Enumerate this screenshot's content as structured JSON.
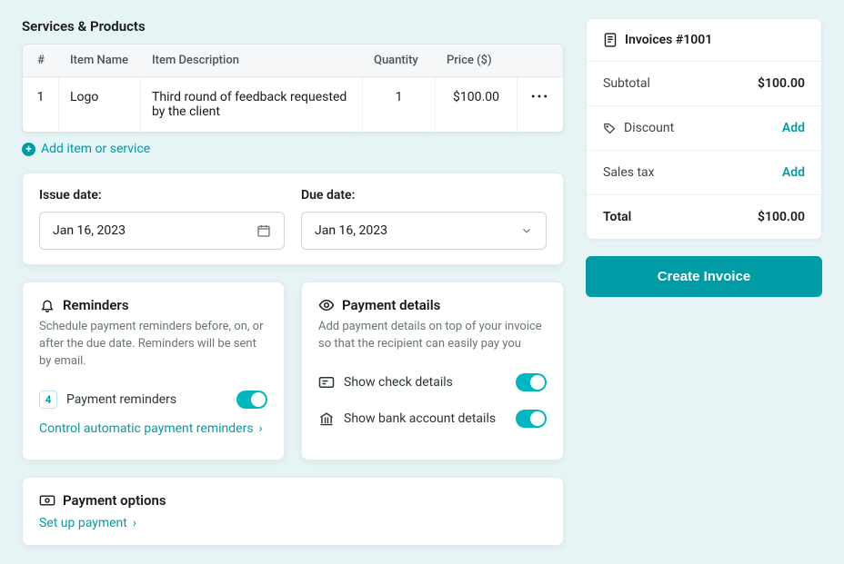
{
  "services": {
    "title": "Services & Products",
    "columns": {
      "num": "#",
      "name": "Item Name",
      "desc": "Item Description",
      "qty": "Quantity",
      "price": "Price ($)"
    },
    "items": [
      {
        "num": "1",
        "name": "Logo",
        "desc": "Third round of feedback requested by the client",
        "qty": "1",
        "price": "$100.00"
      }
    ],
    "addLabel": "Add item or service"
  },
  "dates": {
    "issueLabel": "Issue date:",
    "issueValue": "Jan 16, 2023",
    "dueLabel": "Due date:",
    "dueValue": "Jan 16, 2023"
  },
  "reminders": {
    "title": "Reminders",
    "desc": "Schedule payment reminders before, on, or after the due date. Reminders will be sent by email.",
    "count": "4",
    "rowLabel": "Payment reminders",
    "controlLabel": "Control automatic payment reminders"
  },
  "payment": {
    "title": "Payment details",
    "desc": "Add payment details on top of your invoice so that the recipient can easily pay you",
    "checkLabel": "Show check details",
    "bankLabel": "Show bank account details"
  },
  "options": {
    "title": "Payment options",
    "link": "Set up payment"
  },
  "summary": {
    "title": "Invoices #1001",
    "subtotalLabel": "Subtotal",
    "subtotalValue": "$100.00",
    "discountLabel": "Discount",
    "taxLabel": "Sales tax",
    "addLabel": "Add",
    "totalLabel": "Total",
    "totalValue": "$100.00",
    "createLabel": "Create Invoice"
  }
}
